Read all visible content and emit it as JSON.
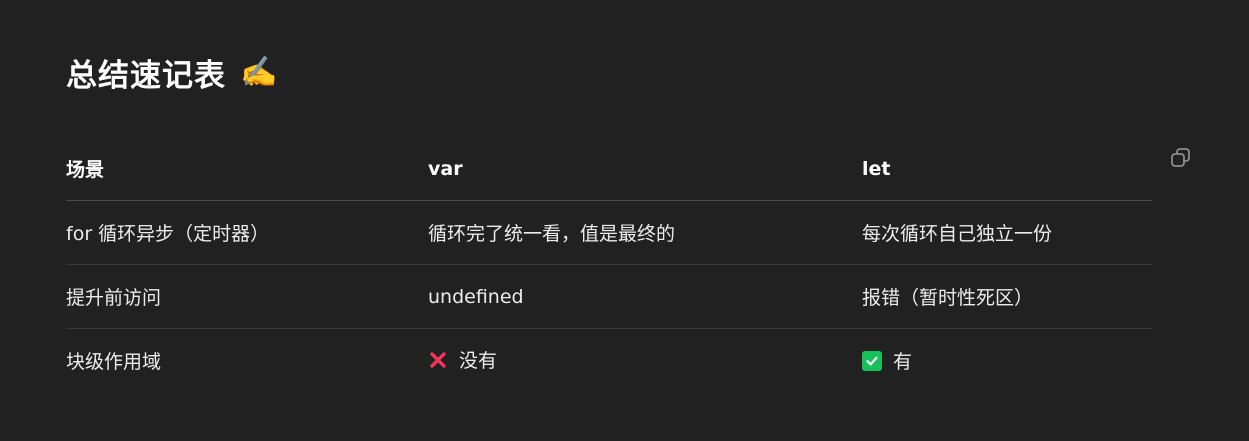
{
  "heading": {
    "title": "总结速记表",
    "emoji": "✍️"
  },
  "copy_button": {
    "icon": "copy-icon",
    "icon_color": "#8e8e8e"
  },
  "table": {
    "headers": [
      "场景",
      "var",
      "let"
    ],
    "rows": [
      {
        "scenario": "for 循环异步（定时器）",
        "var": "循环完了统一看，值是最终的",
        "let": "每次循环自己独立一份"
      },
      {
        "scenario": "提升前访问",
        "var": "undefined",
        "let": "报错（暂时性死区）"
      },
      {
        "scenario": "块级作用域",
        "var": "没有",
        "var_icon": "cross-mark-icon",
        "let": "有",
        "let_icon": "check-mark-icon"
      }
    ]
  },
  "colors": {
    "background": "#212121",
    "cross": "#f0365a",
    "check": "#19c15d"
  }
}
